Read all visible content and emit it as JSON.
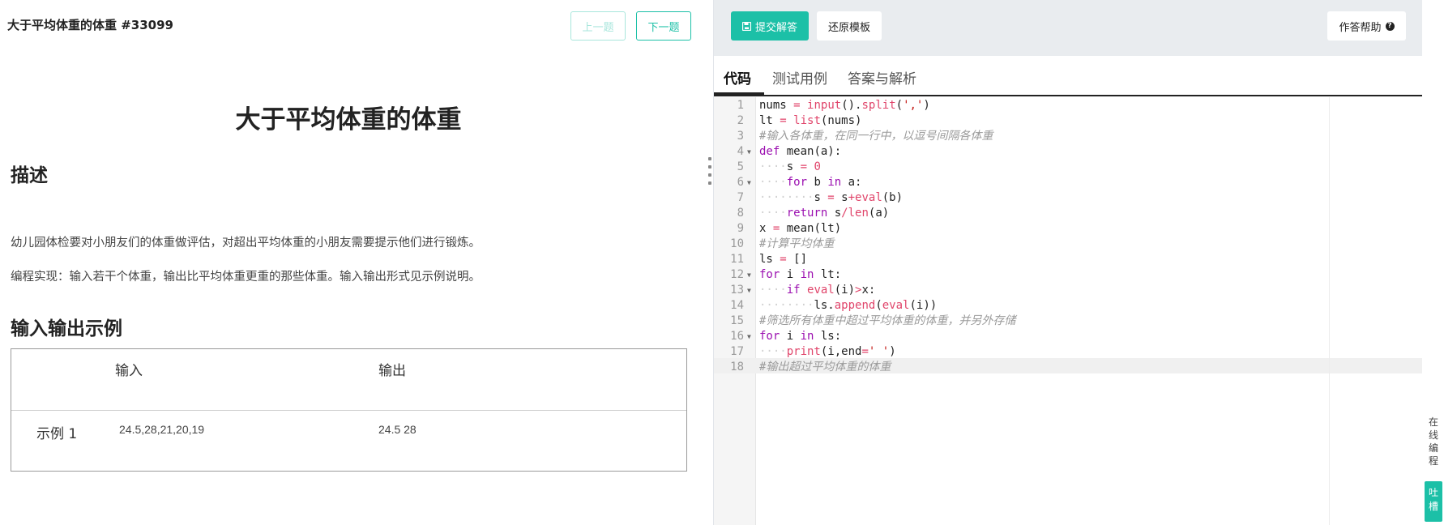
{
  "problem": {
    "header_title": "大于平均体重的体重 #33099",
    "prev_label": "上一题",
    "next_label": "下一题",
    "main_title": "大于平均体重的体重",
    "description_heading": "描述",
    "description_p1": "幼儿园体检要对小朋友们的体重做评估，对超出平均体重的小朋友需要提示他们进行锻炼。",
    "description_p2": "编程实现：输入若干个体重，输出比平均体重更重的那些体重。输入输出形式见示例说明。",
    "examples_heading": "输入输出示例",
    "table": {
      "col_input": "输入",
      "col_output": "输出",
      "rows": [
        {
          "label": "示例 1",
          "input": "24.5,28,21,20,19",
          "output": "24.5 28"
        }
      ]
    }
  },
  "toolbar": {
    "submit_label": "提交解答",
    "restore_label": "还原模板",
    "help_label": "作答帮助",
    "accent_color": "#1cc0a7"
  },
  "tabs": [
    {
      "label": "代码",
      "active": true
    },
    {
      "label": "测试用例",
      "active": false
    },
    {
      "label": "答案与解析",
      "active": false
    }
  ],
  "editor": {
    "active_line": 18,
    "lines": [
      "nums = input().split(',')",
      "lt = list(nums)",
      "#输入各体重，在同一行中，以逗号间隔各体重",
      "def mean(a):",
      "    s = 0",
      "    for b in a:",
      "        s = s+eval(b)",
      "    return s/len(a)",
      "x = mean(lt)",
      "#计算平均体重",
      "ls = []",
      "for i in lt:",
      "    if eval(i)>x:",
      "        ls.append(eval(i))",
      "#筛选所有体重中超过平均体重的体重，并另外存储",
      "for i in ls:",
      "    print(i,end=' ')",
      "#输出超过平均体重的体重"
    ]
  },
  "side": {
    "online_edit_label": "在线编程",
    "feedback_label": "吐槽"
  }
}
